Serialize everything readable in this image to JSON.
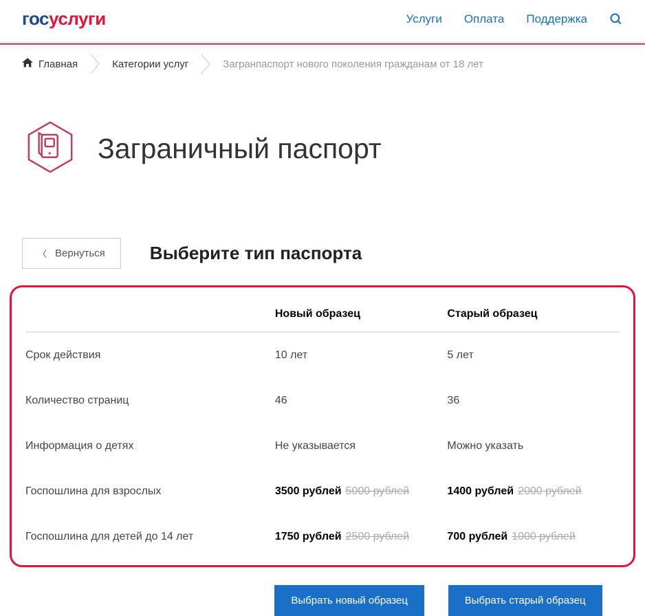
{
  "header": {
    "logo": {
      "part1": "гос",
      "part2": "услуги"
    },
    "nav": [
      "Услуги",
      "Оплата",
      "Поддержка"
    ]
  },
  "breadcrumb": {
    "home": "Главная",
    "categories": "Категории услуг",
    "current": "Загранпаспорт нового поколения гражданам от 18 лет"
  },
  "page_title": "Заграничный паспорт",
  "back_button": "Вернуться",
  "subtitle": "Выберите тип паспорта",
  "table": {
    "headers": {
      "label": "",
      "new": "Новый образец",
      "old": "Старый образец"
    },
    "rows": [
      {
        "label": "Срок действия",
        "new": "10 лет",
        "old": "5 лет"
      },
      {
        "label": "Количество страниц",
        "new": "46",
        "old": "36"
      },
      {
        "label": "Информация о детях",
        "new": "Не указывается",
        "old": "Можно указать"
      }
    ],
    "price_rows": [
      {
        "label": "Госпошлина для взрослых",
        "new_price": "3500 рублей",
        "new_old": "5000 рублей",
        "old_price": "1400 рублей",
        "old_old": "2000 рублей"
      },
      {
        "label": "Госпошлина для детей до 14 лет",
        "new_price": "1750 рублей",
        "new_old": "2500 рублей",
        "old_price": "700 рублей",
        "old_old": "1000 рублей"
      }
    ]
  },
  "buttons": {
    "new": "Выбрать новый образец",
    "old": "Выбрать старый образец"
  }
}
